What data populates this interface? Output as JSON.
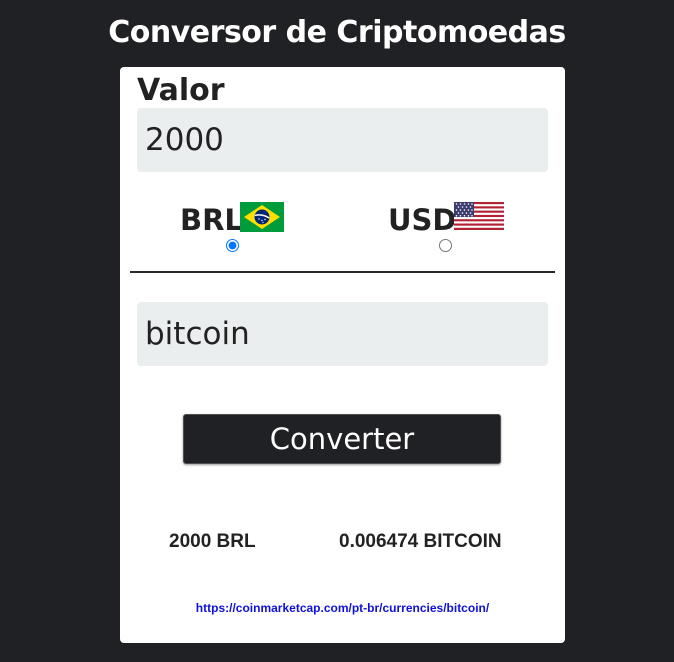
{
  "header": {
    "title": "Conversor de Criptomoedas"
  },
  "form": {
    "value_label": "Valor",
    "value_input": "2000",
    "coin_input": "bitcoin",
    "currencies": [
      {
        "code": "BRL",
        "flag": "brazil-flag-icon",
        "selected": true
      },
      {
        "code": "USD",
        "flag": "usa-flag-icon",
        "selected": false
      }
    ],
    "convert_label": "Converter"
  },
  "result": {
    "from": "2000 BRL",
    "to": "0.006474 BITCOIN"
  },
  "source": {
    "link_text": "https://coinmarketcap.com/pt-br/currencies/bitcoin/"
  },
  "colors": {
    "background": "#202124",
    "card": "#ffffff",
    "input_bg": "#ebeeef",
    "button_bg": "#202124",
    "link": "#1010dd"
  }
}
